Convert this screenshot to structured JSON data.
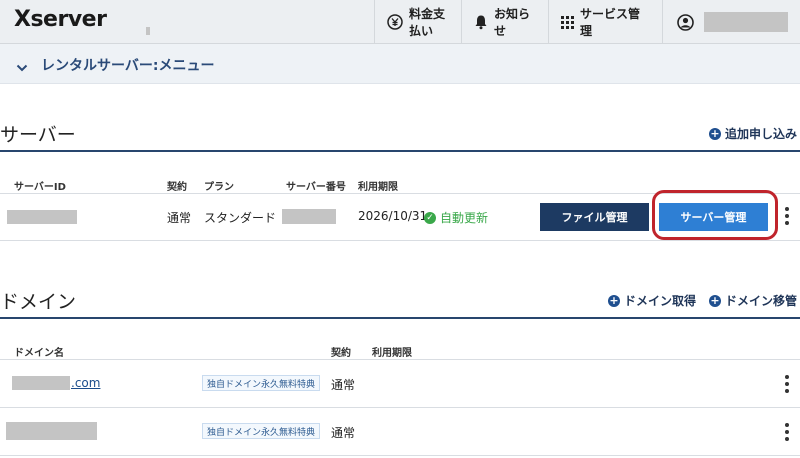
{
  "header": {
    "logo": "Xserver",
    "nav": {
      "payment": "料金支払い",
      "news": "お知らせ",
      "services": "サービス管理"
    }
  },
  "menubar": {
    "label": "レンタルサーバー:メニュー"
  },
  "server_section": {
    "title": "サーバー",
    "action": "追加申し込み",
    "columns": [
      "サーバーID",
      "契約",
      "プラン",
      "サーバー番号",
      "利用期限"
    ],
    "row": {
      "contract": "通常",
      "plan": "スタンダード",
      "expiry": "2026/10/31",
      "auto_renew": "自動更新",
      "file_button": "ファイル管理",
      "server_button": "サーバー管理"
    }
  },
  "domain_section": {
    "title": "ドメイン",
    "actions": {
      "acquire": "ドメイン取得",
      "transfer": "ドメイン移管"
    },
    "columns": [
      "ドメイン名",
      "契約",
      "利用期限"
    ],
    "rows": [
      {
        "domain_suffix": ".com",
        "badge": "独自ドメイン永久無料特典",
        "contract": "通常"
      },
      {
        "domain_suffix": "",
        "badge": "独自ドメイン永久無料特典",
        "contract": "通常"
      }
    ]
  },
  "colors": {
    "accent_dark": "#1d3a62",
    "accent_blue": "#2e7fd4",
    "highlight_red": "#c0242c",
    "success_green": "#3aa84a"
  },
  "icons": [
    "yen-icon",
    "bell-icon",
    "grid-icon",
    "user-icon",
    "chevron-down-icon",
    "plus-circle-icon",
    "check-circle-icon",
    "kebab-icon"
  ]
}
